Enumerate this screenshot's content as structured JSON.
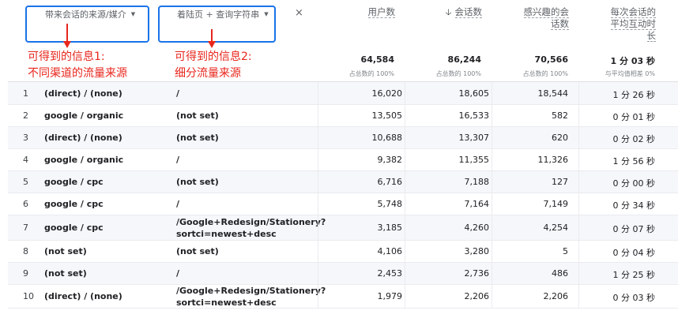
{
  "dimensions": {
    "primary": {
      "label": "带来会话的来源/媒介"
    },
    "secondary": {
      "label": "着陆页 + 查询字符串"
    },
    "remove_label": "×"
  },
  "annotations": {
    "info1": {
      "line1": "可得到的信息1:",
      "line2": "不同渠道的流量来源"
    },
    "info2": {
      "line1": "可得到的信息2:",
      "line2": "细分流量来源"
    }
  },
  "metrics": {
    "users": {
      "label": "用户数",
      "total": "64,584",
      "sub": "占总数的 100%"
    },
    "sessions": {
      "label": "会话数",
      "sort_arrow": "🡣",
      "total": "86,244",
      "sub": "占总数的 100%"
    },
    "engaged": {
      "line1": "感兴趣的会",
      "line2": "话数",
      "total": "70,566",
      "sub": "占总数的 100%"
    },
    "engagement_time": {
      "line1": "每次会话的",
      "line2": "平均互动时",
      "line3": "长",
      "total": "1 分 03 秒",
      "sub": "与平均值相差 0%"
    }
  },
  "rows": [
    {
      "idx": "1",
      "source": "(direct) / (none)",
      "page1": "/",
      "page2": "",
      "users": "16,020",
      "sessions": "18,605",
      "engaged": "18,544",
      "time": "1 分 26 秒"
    },
    {
      "idx": "2",
      "source": "google / organic",
      "page1": "(not set)",
      "page2": "",
      "users": "13,505",
      "sessions": "16,533",
      "engaged": "582",
      "time": "0 分 01 秒"
    },
    {
      "idx": "3",
      "source": "(direct) / (none)",
      "page1": "(not set)",
      "page2": "",
      "users": "10,688",
      "sessions": "13,307",
      "engaged": "620",
      "time": "0 分 02 秒"
    },
    {
      "idx": "4",
      "source": "google / organic",
      "page1": "/",
      "page2": "",
      "users": "9,382",
      "sessions": "11,355",
      "engaged": "11,326",
      "time": "1 分 56 秒"
    },
    {
      "idx": "5",
      "source": "google / cpc",
      "page1": "(not set)",
      "page2": "",
      "users": "6,716",
      "sessions": "7,188",
      "engaged": "127",
      "time": "0 分 00 秒"
    },
    {
      "idx": "6",
      "source": "google / cpc",
      "page1": "/",
      "page2": "",
      "users": "5,748",
      "sessions": "7,164",
      "engaged": "7,149",
      "time": "0 分 34 秒"
    },
    {
      "idx": "7",
      "source": "google / cpc",
      "page1": "/Google+Redesign/Stationery?",
      "page2": "sortci=newest+desc",
      "users": "3,185",
      "sessions": "4,260",
      "engaged": "4,254",
      "time": "0 分 07 秒"
    },
    {
      "idx": "8",
      "source": "(not set)",
      "page1": "(not set)",
      "page2": "",
      "users": "4,106",
      "sessions": "3,280",
      "engaged": "5",
      "time": "0 分 04 秒"
    },
    {
      "idx": "9",
      "source": "(not set)",
      "page1": "/",
      "page2": "",
      "users": "2,453",
      "sessions": "2,736",
      "engaged": "486",
      "time": "1 分 25 秒"
    },
    {
      "idx": "10",
      "source": "(direct) / (none)",
      "page1": "/Google+Redesign/Stationery?",
      "page2": "sortci=newest+desc",
      "users": "1,979",
      "sessions": "2,206",
      "engaged": "2,206",
      "time": "0 分 03 秒"
    }
  ]
}
